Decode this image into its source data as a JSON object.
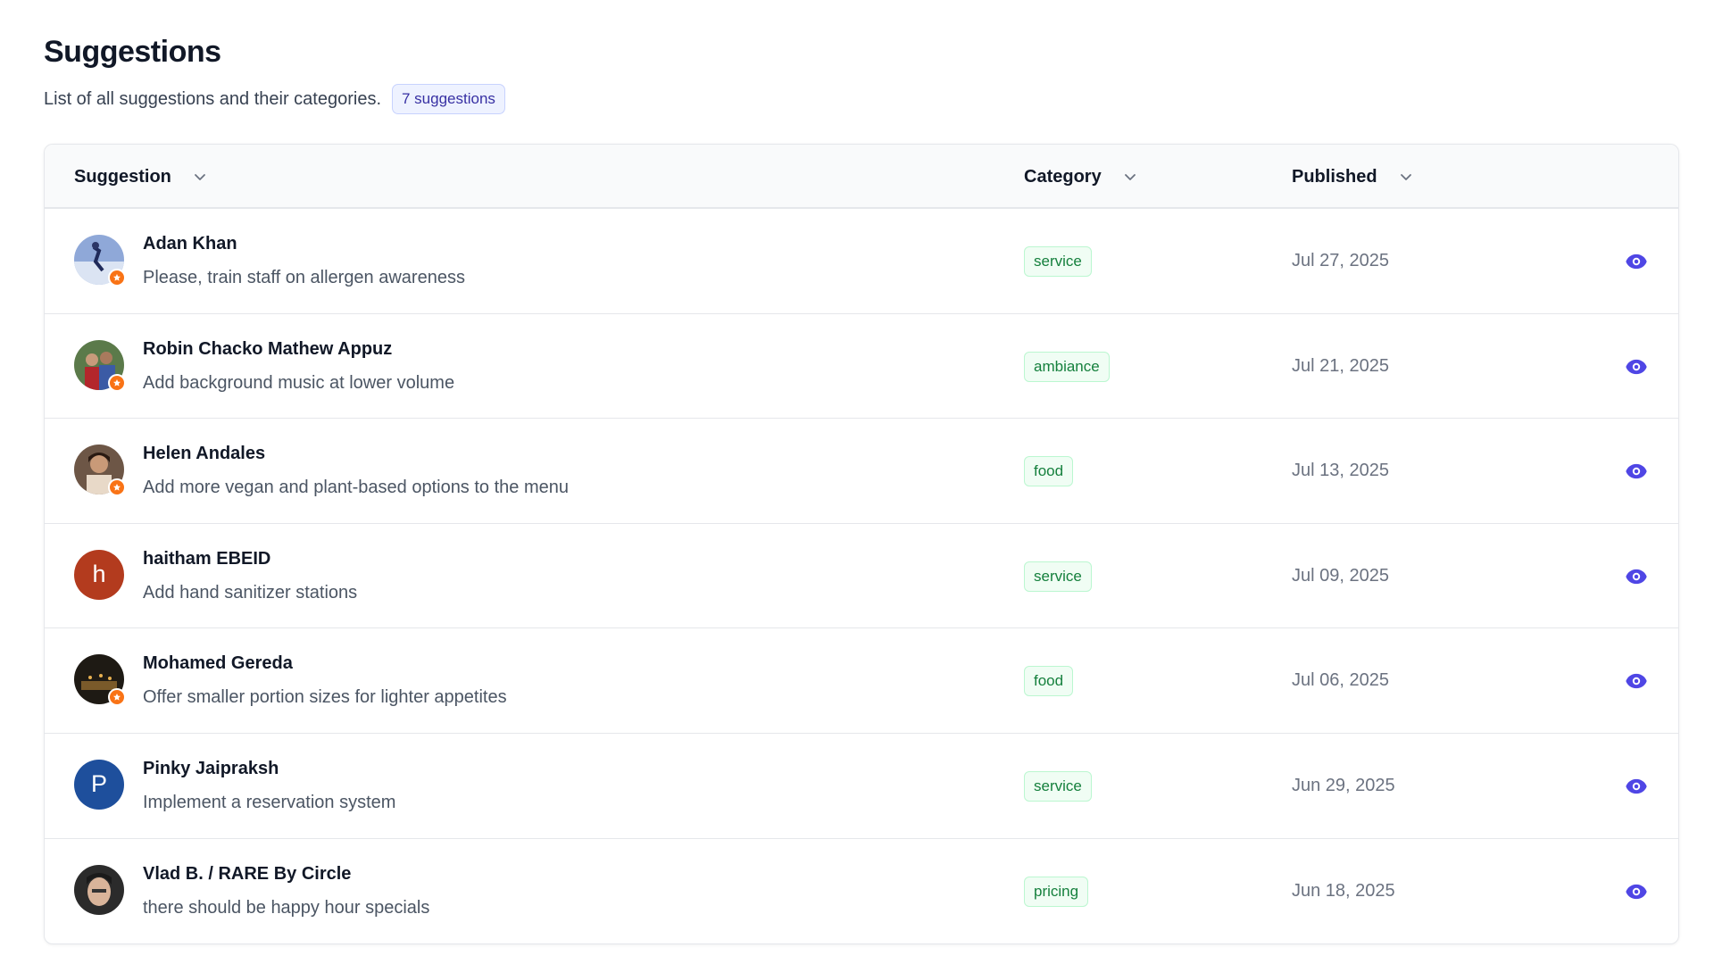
{
  "header": {
    "title": "Suggestions",
    "subtitle": "List of all suggestions and their categories.",
    "count_badge": "7 suggestions"
  },
  "table": {
    "columns": [
      "Suggestion",
      "Category",
      "Published"
    ],
    "rows": [
      {
        "name": "Adan Khan",
        "text": "Please, train staff on allergen awareness",
        "category": "service",
        "published": "Jul 27, 2025"
      },
      {
        "name": "Robin Chacko Mathew Appuz",
        "text": "Add background music at lower volume",
        "category": "ambiance",
        "published": "Jul 21, 2025"
      },
      {
        "name": "Helen Andales",
        "text": "Add more vegan and plant-based options to the menu",
        "category": "food",
        "published": "Jul 13, 2025"
      },
      {
        "name": "haitham EBEID",
        "text": "Add hand sanitizer stations",
        "category": "service",
        "published": "Jul 09, 2025",
        "initial": "h"
      },
      {
        "name": "Mohamed Gereda",
        "text": "Offer smaller portion sizes for lighter appetites",
        "category": "food",
        "published": "Jul 06, 2025"
      },
      {
        "name": "Pinky Jaipraksh",
        "text": "Implement a reservation system",
        "category": "service",
        "published": "Jun 29, 2025",
        "initial": "P"
      },
      {
        "name": "Vlad B. / RARE By Circle",
        "text": "there should be happy hour specials",
        "category": "pricing",
        "published": "Jun 18, 2025"
      }
    ]
  },
  "colors": {
    "accent": "#4f46e5",
    "tag_text": "#15803d",
    "tag_bg": "#f0fdf4",
    "avatar_h": "#b33b1e",
    "avatar_p": "#1e4f9c"
  },
  "icons": {
    "sort": "chevron-down-icon",
    "view": "eye-icon",
    "avatar_badge": "star-badge-icon"
  }
}
